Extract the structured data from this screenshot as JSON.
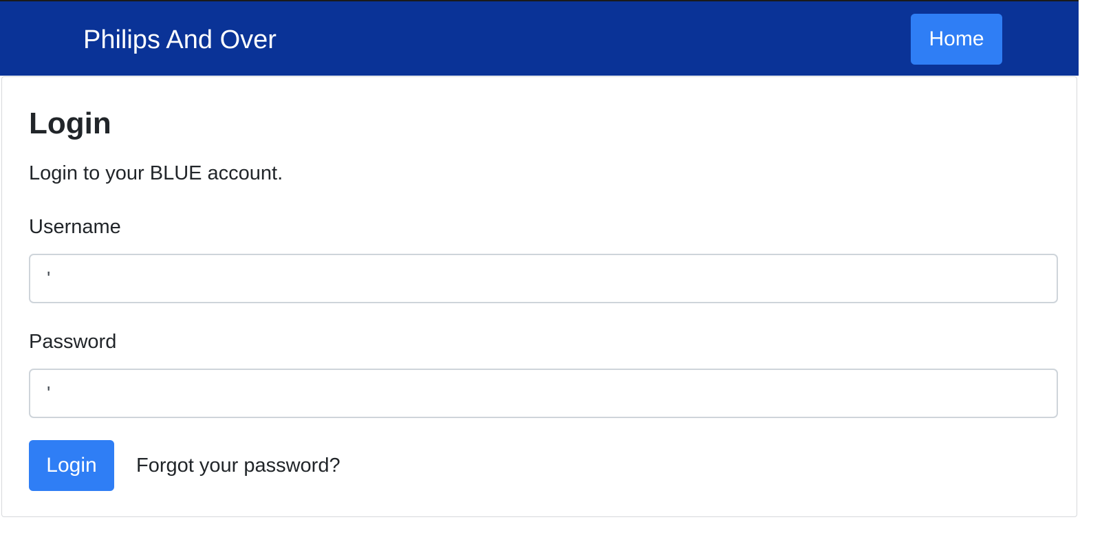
{
  "navbar": {
    "brand": "Philips And Over",
    "home_label": "Home",
    "background_color": "#0a3397",
    "button_color": "#2f7ef5"
  },
  "login": {
    "title": "Login",
    "subtitle": "Login to your BLUE account.",
    "username_label": "Username",
    "username_value": "'",
    "password_label": "Password",
    "password_value": "'",
    "submit_label": "Login",
    "forgot_label": "Forgot your password?"
  }
}
